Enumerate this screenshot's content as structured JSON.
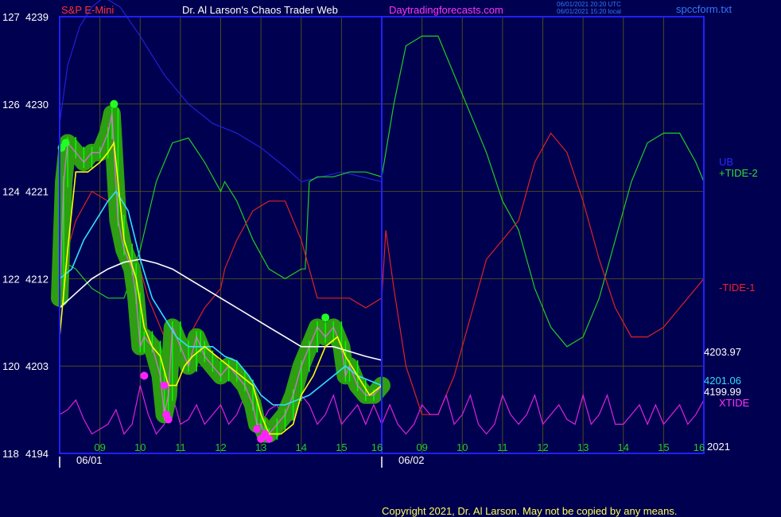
{
  "header": {
    "instrument": "S&P E-Mini",
    "site_title": "Dr. Al Larson's Chaos Trader Web",
    "site_link": "Daytradingforecasts.com",
    "timestamp_utc": "06/01/2021 20:20 UTC",
    "timestamp_local": "06/01/2021 15:20 local",
    "file_name": "spccform.txt"
  },
  "colors": {
    "background": "#000050",
    "frame": "#2020ff",
    "grid": "#4a4a1e",
    "price_bars": "#00ff00",
    "price_glow": "#2e9e12",
    "fast_avg": "#ffff00",
    "mid_avg": "#33ddff",
    "slow_avg": "#ffffff",
    "ub": "#2020dd",
    "tide_plus": "#22cc22",
    "tide_minus": "#dd2222",
    "xtide": "#dd22dd",
    "marker_magenta": "#ff22ff",
    "marker_green": "#22ff22"
  },
  "labels": {
    "ub": "UB",
    "tide_plus": "+TIDE-2",
    "tide_minus": "-TIDE-1",
    "xtide": "XTIDE",
    "value_slow": "4203.97",
    "value_mid": "4201.06",
    "value_last": "4199.99",
    "year": "2021",
    "date1": "06/01",
    "date2": "06/02"
  },
  "copyright": "Copyright 2021, Dr. Al Larson. May not be copied by any means.",
  "chart_data": {
    "type": "line",
    "title": "S&P E-Mini",
    "grid": true,
    "y_ticks": [
      {
        "left": "127",
        "price": "4239"
      },
      {
        "left": "126",
        "price": "4230"
      },
      {
        "left": "124",
        "price": "4221"
      },
      {
        "left": "122",
        "price": "4212"
      },
      {
        "left": "120",
        "price": "4203"
      },
      {
        "left": "118",
        "price": "4194"
      }
    ],
    "ylim": [
      4194,
      4239
    ],
    "x_ticks": [
      "09",
      "10",
      "11",
      "12",
      "13",
      "14",
      "15",
      "16",
      "09",
      "10",
      "11",
      "12",
      "13",
      "14",
      "15",
      "16"
    ],
    "xlim": [
      8,
      24
    ],
    "x_dates": [
      {
        "label": "06/01",
        "at": 8.5
      },
      {
        "label": "06/02",
        "at": 16.5
      }
    ],
    "series": [
      {
        "name": "S&P E-Mini",
        "key": "price",
        "x": [
          8.0,
          8.1,
          8.2,
          8.4,
          8.6,
          8.8,
          9.0,
          9.2,
          9.3,
          9.45,
          9.6,
          9.8,
          9.9,
          10.0,
          10.1,
          10.3,
          10.5,
          10.6,
          10.7,
          10.8,
          11.0,
          11.2,
          11.4,
          11.5,
          11.6,
          11.8,
          12.0,
          12.2,
          12.4,
          12.6,
          12.8,
          12.9,
          13.0,
          13.1,
          13.2,
          13.4,
          13.6,
          13.8,
          14.0,
          14.2,
          14.4,
          14.6,
          14.8,
          15.0,
          15.1,
          15.2,
          15.4,
          15.6,
          15.8,
          16.0
        ],
        "y": [
          4210,
          4222,
          4226,
          4225,
          4224,
          4225,
          4225,
          4227,
          4229,
          4218,
          4215,
          4213,
          4210,
          4205,
          4206,
          4205,
          4202,
          4198,
          4200,
          4207,
          4205,
          4203,
          4206,
          4205,
          4204,
          4203,
          4202,
          4203,
          4202,
          4201,
          4199,
          4197,
          4197,
          4196,
          4196,
          4197,
          4198,
          4200,
          4203,
          4205,
          4207,
          4206,
          4207,
          4205,
          4202,
          4203,
          4201,
          4200,
          4200,
          4201
        ]
      },
      {
        "name": "fast avg",
        "key": "fast",
        "x": [
          8.0,
          8.2,
          8.4,
          8.7,
          9.0,
          9.2,
          9.35,
          9.6,
          9.9,
          10.1,
          10.3,
          10.5,
          10.7,
          10.9,
          11.1,
          11.3,
          11.6,
          11.9,
          12.2,
          12.5,
          12.8,
          13.0,
          13.2,
          13.5,
          13.8,
          14.0,
          14.3,
          14.6,
          14.9,
          15.1,
          15.4,
          15.7,
          16.0
        ],
        "y": [
          4206,
          4215,
          4223,
          4223,
          4224,
          4225,
          4226,
          4216,
          4212,
          4207,
          4205,
          4204,
          4201,
          4201,
          4203,
          4204,
          4205,
          4204,
          4203,
          4202,
          4201,
          4198,
          4196,
          4196,
          4197,
          4200,
          4202,
          4205,
          4206,
          4204,
          4202,
          4200,
          4201
        ]
      },
      {
        "name": "mid avg",
        "key": "mid",
        "x": [
          8.0,
          8.3,
          8.6,
          8.9,
          9.2,
          9.4,
          9.7,
          10.0,
          10.3,
          10.6,
          10.9,
          11.2,
          11.5,
          11.8,
          12.1,
          12.4,
          12.7,
          13.0,
          13.3,
          13.6,
          13.9,
          14.2,
          14.5,
          14.8,
          15.1,
          15.4,
          15.7,
          16.0
        ],
        "y": [
          4212,
          4213,
          4216,
          4218,
          4220,
          4221,
          4219,
          4214,
          4210,
          4208,
          4206,
          4205,
          4205,
          4205,
          4204,
          4203.5,
          4202,
          4200,
          4199,
          4199,
          4199.5,
          4200,
          4201,
          4202,
          4203,
          4202,
          4201.5,
          4201
        ]
      },
      {
        "name": "slow avg",
        "key": "slow",
        "x": [
          8.0,
          8.4,
          8.8,
          9.2,
          9.6,
          10.0,
          10.4,
          10.8,
          11.2,
          11.6,
          12.0,
          12.4,
          12.8,
          13.2,
          13.6,
          14.0,
          14.4,
          14.8,
          15.2,
          15.6,
          16.0
        ],
        "y": [
          4209,
          4210.5,
          4212,
          4213,
          4213.7,
          4214,
          4213.6,
          4213,
          4212,
          4211,
          4210,
          4209,
          4208,
          4207,
          4206,
          4205,
          4205,
          4205,
          4204.5,
          4204,
          4203.6
        ]
      },
      {
        "name": "UB",
        "key": "ub",
        "x": [
          8.0,
          8.2,
          8.5,
          8.8,
          9.1,
          9.5,
          10.0,
          10.6,
          11.2,
          11.8,
          12.4,
          13.0,
          13.6,
          14.0,
          14.5,
          15.0,
          15.5,
          16.0
        ],
        "y": [
          4228,
          4234,
          4238,
          4240,
          4241,
          4240,
          4237,
          4233,
          4230,
          4228,
          4227,
          4225.5,
          4223.5,
          4222,
          4222.5,
          4223,
          4222.5,
          4222
        ]
      },
      {
        "name": "+TIDE-2",
        "key": "tplus",
        "x": [
          8.0,
          8.4,
          8.8,
          9.2,
          9.6,
          10.0,
          10.4,
          10.8,
          11.2,
          11.6,
          12.0,
          12.1,
          12.4,
          12.8,
          13.2,
          13.6,
          14.0,
          14.1,
          14.2,
          14.4,
          14.8,
          15.2,
          15.6,
          16.0,
          16.3,
          16.6,
          17.0,
          17.4,
          17.8,
          18.2,
          18.6,
          19.0,
          19.4,
          19.8,
          20.2,
          20.6,
          21.0,
          21.4,
          21.8,
          22.2,
          22.6,
          23.0,
          23.4,
          23.8,
          24.0
        ],
        "y": [
          4214,
          4213,
          4211,
          4210,
          4210,
          4215,
          4222,
          4226,
          4226.5,
          4224,
          4221,
          4222,
          4220,
          4216,
          4213,
          4212,
          4213,
          4213,
          4222,
          4222.5,
          4222.5,
          4223,
          4223,
          4222.5,
          4230,
          4236,
          4237,
          4237,
          4233,
          4229,
          4225,
          4220,
          4217,
          4211,
          4207,
          4205,
          4206,
          4210,
          4216,
          4222,
          4226,
          4227,
          4227,
          4224,
          4222
        ]
      },
      {
        "name": "-TIDE-1",
        "key": "tminus",
        "x": [
          8.0,
          8.4,
          8.8,
          9.2,
          9.6,
          10.0,
          10.2,
          10.4,
          10.6,
          10.8,
          11.0,
          11.2,
          11.6,
          12.0,
          12.1,
          12.4,
          12.8,
          13.2,
          13.6,
          14.0,
          14.2,
          14.4,
          14.8,
          15.2,
          15.6,
          16.0,
          16.1,
          16.3,
          16.6,
          17.0,
          17.4,
          17.8,
          18.2,
          18.6,
          19.0,
          19.4,
          19.8,
          20.2,
          20.6,
          21.0,
          21.4,
          21.8,
          22.2,
          22.6,
          23.0,
          23.4,
          23.8,
          24.0
        ],
        "y": [
          4212,
          4218,
          4221,
          4220,
          4217,
          4213,
          4210,
          4208,
          4206,
          4205,
          4205,
          4206,
          4209,
          4211,
          4213,
          4216,
          4219,
          4220,
          4220,
          4216,
          4213,
          4210,
          4210,
          4210,
          4209,
          4210,
          4217,
          4211,
          4203,
          4198,
          4198,
          4202,
          4208,
          4214,
          4216,
          4218,
          4224,
          4227,
          4225,
          4220,
          4214,
          4209,
          4206,
          4206,
          4207,
          4209,
          4211,
          4212
        ]
      },
      {
        "name": "XTIDE",
        "key": "xtide",
        "x": [
          8.0,
          8.2,
          8.4,
          8.6,
          8.8,
          9.0,
          9.2,
          9.4,
          9.6,
          9.8,
          10.0,
          10.2,
          10.4,
          10.6,
          10.8,
          11.0,
          11.2,
          11.4,
          11.6,
          11.8,
          12.0,
          12.2,
          12.4,
          12.6,
          12.8,
          13.0,
          13.2,
          13.4,
          13.6,
          13.8,
          14.0,
          14.2,
          14.4,
          14.6,
          14.8,
          15.0,
          15.2,
          15.4,
          15.6,
          15.8,
          16.0,
          16.2,
          16.4,
          16.6,
          16.8,
          17.0,
          17.2,
          17.4,
          17.6,
          17.8,
          18.0,
          18.2,
          18.4,
          18.6,
          18.8,
          19.0,
          19.2,
          19.4,
          19.6,
          19.8,
          20.0,
          20.2,
          20.4,
          20.6,
          20.8,
          21.0,
          21.2,
          21.4,
          21.6,
          21.8,
          22.0,
          22.2,
          22.4,
          22.6,
          22.8,
          23.0,
          23.2,
          23.4,
          23.6,
          23.8,
          24.0
        ],
        "y": [
          4198,
          4198.5,
          4199.5,
          4197.5,
          4196,
          4196.5,
          4197,
          4198.5,
          4196,
          4197,
          4201,
          4198,
          4196,
          4197,
          4200,
          4197,
          4197.5,
          4199,
          4197,
          4198,
          4199,
          4197,
          4198,
          4200,
          4197,
          4197,
          4198.5,
          4199,
          4197,
          4197.5,
          4200,
          4199,
          4197,
          4198,
          4200,
          4197,
          4198,
          4199,
          4197,
          4199,
          4197,
          4199,
          4197,
          4196,
          4197,
          4199,
          4198,
          4198,
          4200,
          4197,
          4198,
          4200,
          4197,
          4196,
          4197,
          4200,
          4198,
          4197,
          4198,
          4200,
          4197,
          4198,
          4199,
          4197.5,
          4197,
          4200,
          4197,
          4198,
          4200,
          4197,
          4197,
          4198,
          4199,
          4197,
          4199,
          4197,
          4198,
          4199,
          4197,
          4198,
          4199.5
        ]
      }
    ],
    "markers": [
      {
        "series": "price",
        "kind": "high",
        "x": [
          8.05,
          8.15,
          9.35,
          14.6
        ],
        "y": [
          4225.5,
          4226,
          4230,
          4208
        ]
      },
      {
        "series": "price",
        "kind": "low",
        "x": [
          10.1,
          10.6,
          10.65,
          10.7,
          12.9,
          13.0,
          13.1,
          13.2
        ],
        "y": [
          4202,
          4201,
          4198,
          4197.5,
          4196.5,
          4195.5,
          4196,
          4195.5
        ]
      }
    ]
  }
}
